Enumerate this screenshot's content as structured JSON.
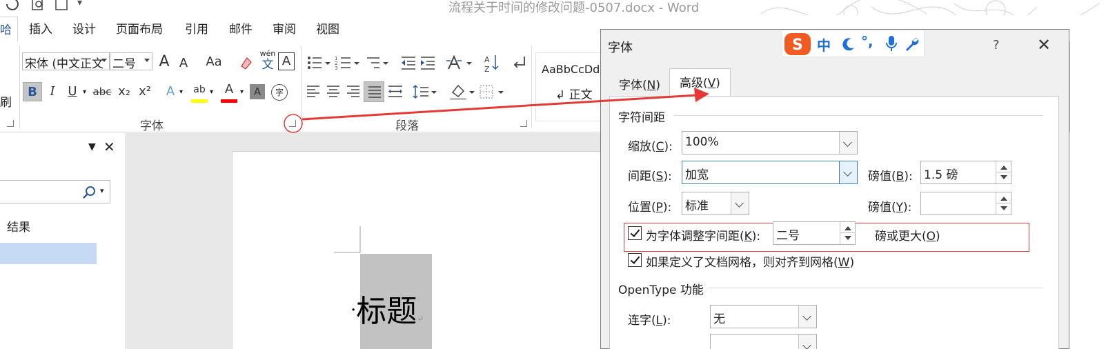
{
  "window": {
    "title": "流程关于时间的修改问题-0507.docx - Word"
  },
  "ribbon": {
    "tabs": [
      "哈",
      "插入",
      "设计",
      "页面布局",
      "引用",
      "邮件",
      "审阅",
      "视图"
    ],
    "font_name": "宋体 (中文正文",
    "font_size": "二号",
    "group_font": "字体",
    "group_paragraph": "段落",
    "brush_label": "刷",
    "styles_sample": "AaBbCcDd",
    "styles_name": "↲ 正文",
    "icons": {
      "grow": "A",
      "shrink": "A",
      "change_case": "Aa",
      "clear_format": "clear-format-icon",
      "phonetic_top": "wén",
      "phonetic_bottom": "文",
      "char_border": "A",
      "bold": "B",
      "italic": "I",
      "underline": "U",
      "strike": "abc",
      "subscript": "x₂",
      "superscript": "x²",
      "text_effects": "A",
      "highlight": "ab",
      "font_color": "A",
      "char_shading": "A",
      "enclose": "字"
    }
  },
  "navpane": {
    "results_label": "结果"
  },
  "document": {
    "heading": "·标题",
    "para_mark": "↵"
  },
  "dialog": {
    "title": "字体",
    "help": "?",
    "close": "✕",
    "tab_font": "字体(N)",
    "tab_font_key": "N",
    "tab_advanced": "高级(V)",
    "tab_advanced_key": "V",
    "section_spacing": "字符间距",
    "scale_label": "缩放(C):",
    "scale_key": "C",
    "scale_value": "100%",
    "spacing_label": "间距(S):",
    "spacing_key": "S",
    "spacing_value": "加宽",
    "by_label": "磅值(B):",
    "by_key": "B",
    "by_value": "1.5 磅",
    "position_label": "位置(P):",
    "position_key": "P",
    "position_value": "标准",
    "by2_label": "磅值(Y):",
    "by2_key": "Y",
    "by2_value": "",
    "kerning_label": "为字体调整字间距(K):",
    "kerning_key": "K",
    "kerning_value": "二号",
    "kerning_suffix": "磅或更大(O)",
    "kerning_suffix_key": "O",
    "snap_label": "如果定义了文档网格，则对齐到网格(W)",
    "snap_key": "W",
    "section_opentype": "OpenType 功能",
    "ligatures_label": "连字(L):",
    "ligatures_key": "L",
    "ligatures_value": "无"
  },
  "ime": {
    "logo": "S",
    "mode": "中",
    "punct": "°,"
  },
  "colors": {
    "accent": "#2b579a",
    "annotation": "#e53935",
    "selection": "#c2c2c2",
    "highlight_bar": "#ffff00",
    "font_color_bar": "#ff0000",
    "ime_orange": "#f15a22",
    "ime_blue": "#1e6fd9"
  }
}
